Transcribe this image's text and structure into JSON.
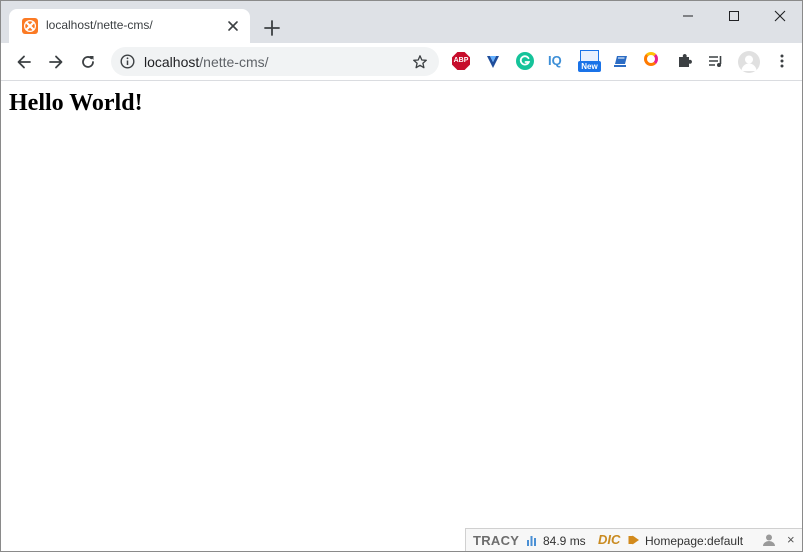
{
  "browser": {
    "tab": {
      "title": "localhost/nette-cms/",
      "favicon": "xampp-icon"
    },
    "omnibox": {
      "host": "localhost",
      "path": "/nette-cms/"
    },
    "extensions": [
      {
        "name": "adblock-plus-icon",
        "label": "ABP"
      },
      {
        "name": "vpn-shield-icon"
      },
      {
        "name": "grammarly-icon",
        "label": "G"
      },
      {
        "name": "iq-icon",
        "label": "IQ"
      },
      {
        "name": "screenshot-new-icon",
        "label": "New"
      },
      {
        "name": "notebook-icon"
      },
      {
        "name": "ring-icon"
      },
      {
        "name": "extensions-puzzle-icon"
      },
      {
        "name": "media-queue-icon"
      }
    ],
    "accent_color": "#1a73e8"
  },
  "page": {
    "heading": "Hello World!"
  },
  "tracy": {
    "logo": "TRACY",
    "time": "84.9 ms",
    "dic": "DIC",
    "route": "Homepage:default",
    "close": "×"
  }
}
